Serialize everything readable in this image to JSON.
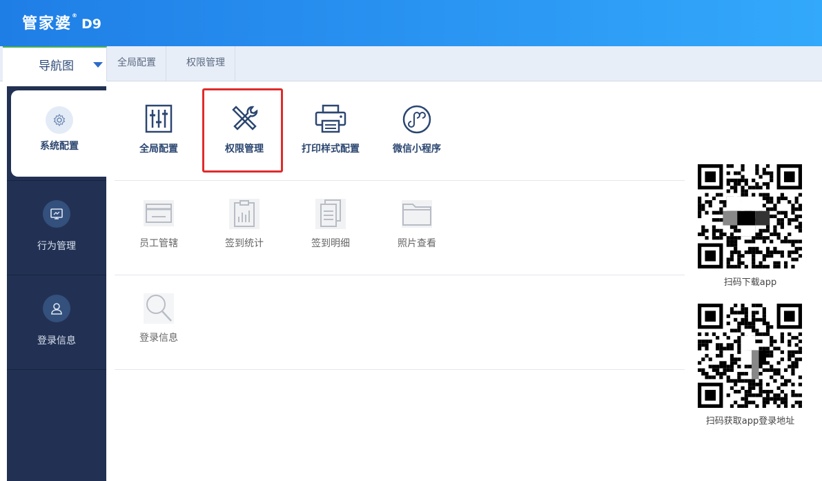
{
  "header": {
    "logo_text": "管家婆",
    "logo_reg": "®",
    "logo_version": "D9"
  },
  "tabbar": {
    "nav_label": "导航图",
    "tabs": [
      {
        "label": "全局配置"
      },
      {
        "label": "权限管理"
      }
    ]
  },
  "sidebar": {
    "items": [
      {
        "label": "系统配置",
        "icon": "gear-icon",
        "active": true
      },
      {
        "label": "行为管理",
        "icon": "monitor-icon",
        "active": false
      },
      {
        "label": "登录信息",
        "icon": "user-icon",
        "active": false
      }
    ]
  },
  "main": {
    "row1": [
      {
        "label": "全局配置",
        "icon": "sliders-icon"
      },
      {
        "label": "权限管理",
        "icon": "tools-icon"
      },
      {
        "label": "打印样式配置",
        "icon": "printer-icon"
      },
      {
        "label": "微信小程序",
        "icon": "mini-program-icon"
      }
    ],
    "row2": [
      {
        "label": "员工管辖",
        "icon": "card-icon"
      },
      {
        "label": "签到统计",
        "icon": "clipboard-chart-icon"
      },
      {
        "label": "签到明细",
        "icon": "document-icon"
      },
      {
        "label": "照片查看",
        "icon": "folder-icon"
      }
    ],
    "row3": [
      {
        "label": "登录信息",
        "icon": "search-icon"
      }
    ]
  },
  "qr": {
    "download_caption": "扫码下载app",
    "login_caption": "扫码获取app登录地址"
  },
  "colors": {
    "header_start": "#1f7ee6",
    "header_end": "#33a9fb",
    "sidebar_bg": "#223153",
    "highlight_border": "#e02a2a",
    "active_icon": "#2b4670",
    "inactive_icon": "#b8bcc4"
  }
}
